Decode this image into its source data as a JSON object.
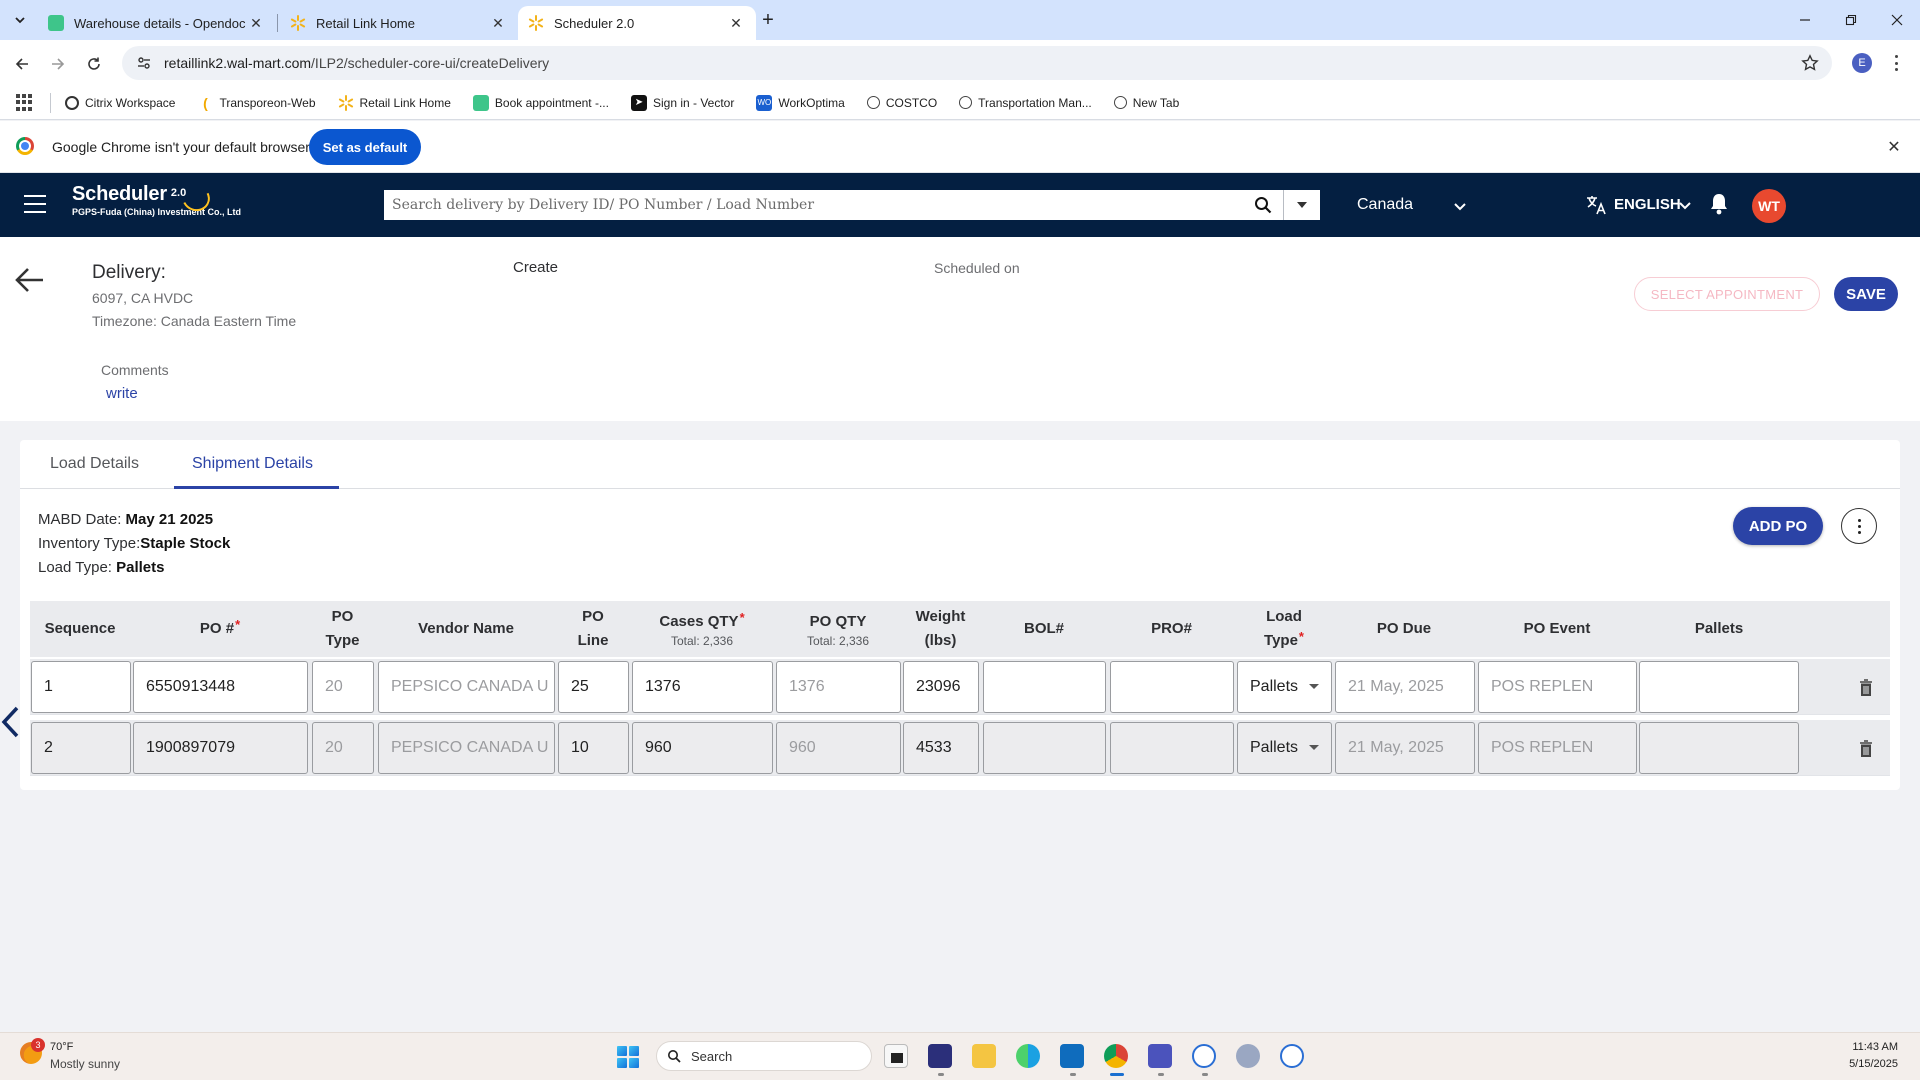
{
  "browser": {
    "tabs": [
      {
        "title": "Warehouse details - Opendock",
        "active": false
      },
      {
        "title": "Retail Link Home",
        "active": false
      },
      {
        "title": "Scheduler 2.0",
        "active": true
      }
    ],
    "url_host": "retaillink2.wal-mart.com",
    "url_path": "/ILP2/scheduler-core-ui/createDelivery",
    "profile_initial": "E",
    "bookmarks": [
      {
        "label": "Citrix Workspace",
        "icon": "citrix-icon"
      },
      {
        "label": "Transporeon-Web",
        "icon": "transporeon-icon"
      },
      {
        "label": "Retail Link Home",
        "icon": "walmart-spark-icon"
      },
      {
        "label": "Book appointment -...",
        "icon": "calendar-icon"
      },
      {
        "label": "Sign in - Vector",
        "icon": "vector-icon"
      },
      {
        "label": "WorkOptima",
        "icon": "workoptima-icon"
      },
      {
        "label": "COSTCO",
        "icon": "globe-icon"
      },
      {
        "label": "Transportation Man...",
        "icon": "globe-icon"
      },
      {
        "label": "New Tab",
        "icon": "globe-icon"
      }
    ],
    "infobar": {
      "message": "Google Chrome isn't your default browser",
      "button": "Set as default"
    }
  },
  "app": {
    "brand_name": "Scheduler",
    "brand_version": "2.0",
    "brand_company": "PGPS-Fuda (China) Investment Co., Ltd",
    "search_placeholder": "Search delivery by Delivery ID/ PO Number / Load Number",
    "country": "Canada",
    "language": "ENGLISH",
    "user_initials": "WT",
    "colors": {
      "header": "#041f41",
      "primary": "#2b43a6",
      "avatar": "#e8492f"
    }
  },
  "delivery": {
    "title": "Delivery:",
    "location": "6097, CA HVDC",
    "timezone": "Timezone: Canada Eastern Time",
    "status": "Create",
    "scheduled_label": "Scheduled on",
    "select_appointment": "SELECT APPOINTMENT",
    "save": "SAVE",
    "comments_label": "Comments",
    "comments_action": "write"
  },
  "shipment": {
    "tabs": [
      "Load Details",
      "Shipment Details"
    ],
    "active_tab": "Shipment Details",
    "mabd_label": "MABD Date: ",
    "mabd_value": "May 21 2025",
    "inventory_label": "Inventory Type:",
    "inventory_value": "Staple Stock",
    "loadtype_label": "Load Type: ",
    "loadtype_value": "Pallets",
    "add_po": "ADD PO",
    "columns": {
      "sequence": "Sequence",
      "po_num": "PO #",
      "po_type_1": "PO",
      "po_type_2": "Type",
      "vendor": "Vendor Name",
      "po_line_1": "PO",
      "po_line_2": "Line",
      "cases_qty": "Cases QTY",
      "cases_total": "Total: 2,336",
      "po_qty": "PO QTY",
      "po_qty_total": "Total: 2,336",
      "weight_1": "Weight",
      "weight_2": "(lbs)",
      "bol": "BOL#",
      "pro": "PRO#",
      "load_type_1": "Load",
      "load_type_2": "Type",
      "po_due": "PO Due",
      "po_event": "PO Event",
      "pallets": "Pallets",
      "required_mark": "*"
    },
    "rows": [
      {
        "sequence": "1",
        "po": "6550913448",
        "po_type": "20",
        "vendor": "PEPSICO CANADA U",
        "po_line": "25",
        "cases": "1376",
        "po_qty": "1376",
        "weight": "23096",
        "bol": "",
        "pro": "",
        "load_type": "Pallets",
        "po_due": "21 May, 2025",
        "po_event": "POS REPLEN",
        "pallets": ""
      },
      {
        "sequence": "2",
        "po": "1900897079",
        "po_type": "20",
        "vendor": "PEPSICO CANADA U",
        "po_line": "10",
        "cases": "960",
        "po_qty": "960",
        "weight": "4533",
        "bol": "",
        "pro": "",
        "load_type": "Pallets",
        "po_due": "21 May, 2025",
        "po_event": "POS REPLEN",
        "pallets": ""
      }
    ]
  },
  "taskbar": {
    "weather_temp": "70°F",
    "weather_desc": "Mostly sunny",
    "weather_badge": "3",
    "search": "Search",
    "time": "11:43 AM",
    "date": "5/15/2025"
  }
}
